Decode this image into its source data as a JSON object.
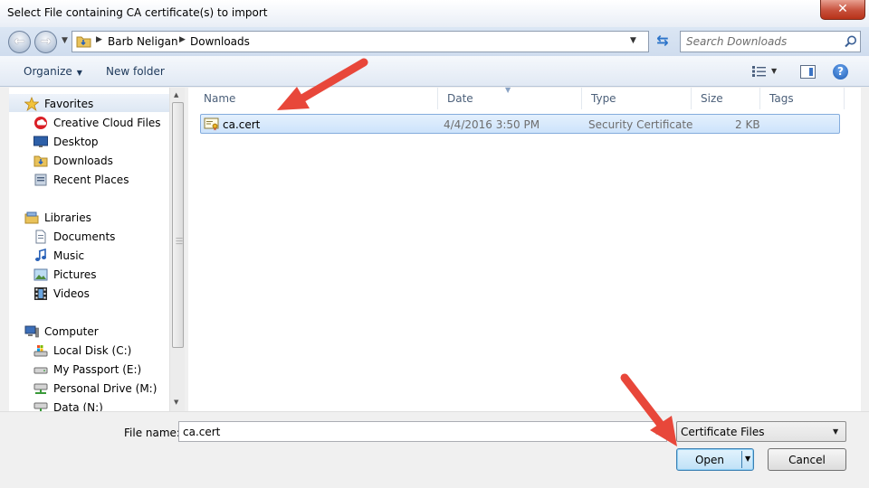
{
  "window": {
    "title": "Select File containing CA certificate(s) to import",
    "close_glyph": "✕"
  },
  "address_bar": {
    "crumbs": [
      "Barb Neligan",
      "Downloads"
    ],
    "separator": "▶"
  },
  "search": {
    "placeholder": "Search Downloads"
  },
  "toolbar": {
    "organize_label": "Organize",
    "new_folder_label": "New folder",
    "help_glyph": "?"
  },
  "nav_pane": {
    "favorites": {
      "label": "Favorites",
      "items": [
        "Creative Cloud Files",
        "Desktop",
        "Downloads",
        "Recent Places"
      ]
    },
    "libraries": {
      "label": "Libraries",
      "items": [
        "Documents",
        "Music",
        "Pictures",
        "Videos"
      ]
    },
    "computer": {
      "label": "Computer",
      "items": [
        "Local Disk (C:)",
        "My Passport (E:)",
        "Personal Drive (M:)",
        "Data (N:)"
      ]
    }
  },
  "file_list": {
    "columns": [
      "Name",
      "Date",
      "Type",
      "Size",
      "Tags"
    ],
    "rows": [
      {
        "name": "ca.cert",
        "date": "4/4/2016 3:50 PM",
        "type": "Security Certificate",
        "size": "2 KB",
        "tags": ""
      }
    ]
  },
  "bottom": {
    "file_name_label": "File name:",
    "file_name_value": "ca.cert",
    "file_type_filter": "Certificate Files",
    "open_label": "Open",
    "cancel_label": "Cancel"
  },
  "colors": {
    "annotation_arrow": "#e8473a",
    "selection": "#cde3fb",
    "title_close": "#c7503b"
  }
}
